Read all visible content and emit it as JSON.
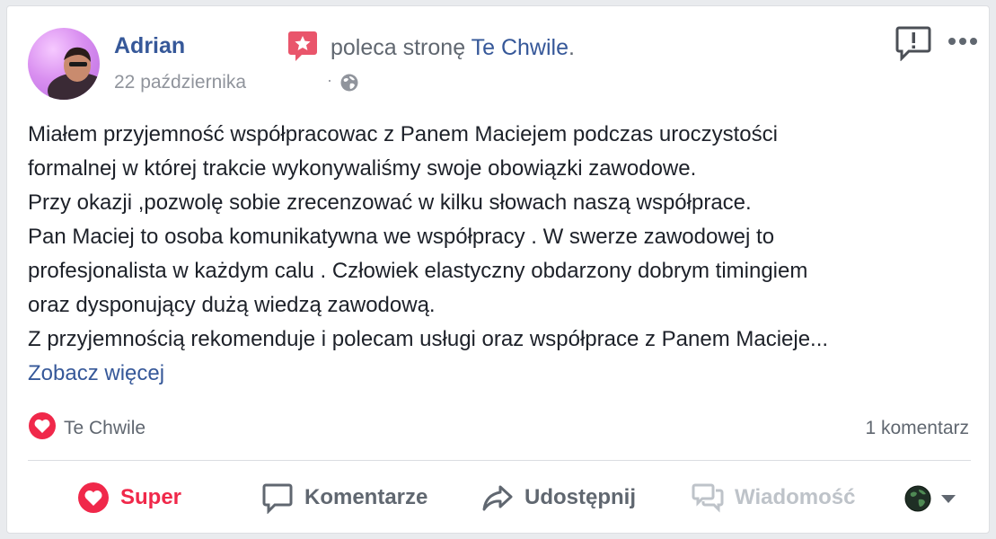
{
  "post": {
    "author": "Adrian",
    "action_text": "poleca stronę",
    "page_name": "Te Chwile",
    "period": ".",
    "date": "22 października",
    "separator": "·",
    "privacy_icon": "globe-icon"
  },
  "review": {
    "lines": [
      "Miałem przyjemność współpracowac z Panem Maciejem podczas uroczystości",
      "formalnej w której trakcie wykonywaliśmy swoje obowiązki zawodowe.",
      "Przy okazji ,pozwolę sobie zrecenzować w kilku słowach naszą współprace.",
      "Pan Maciej to osoba komunikatywna we współpracy . W swerze zawodowej to",
      "profesjonalista w każdym calu . Człowiek elastyczny obdarzony dobrym timingiem",
      "oraz dysponujący dużą wiedzą zawodową.",
      "Z przyjemnością rekomenduje i polecam usługi oraz współprace z Panem Macieje..."
    ],
    "see_more": "Zobacz więcej"
  },
  "reactions": {
    "icon": "heart-icon",
    "name": "Te Chwile",
    "comments": "1 komentarz"
  },
  "actions": {
    "super": "Super",
    "comment": "Komentarze",
    "share": "Udostępnij",
    "message": "Wiadomość"
  },
  "colors": {
    "link": "#365899",
    "love": "#f0284a",
    "recommend": "#e9556b",
    "text": "#1d2129",
    "muted": "#606770",
    "disabled": "#bec3c9"
  }
}
